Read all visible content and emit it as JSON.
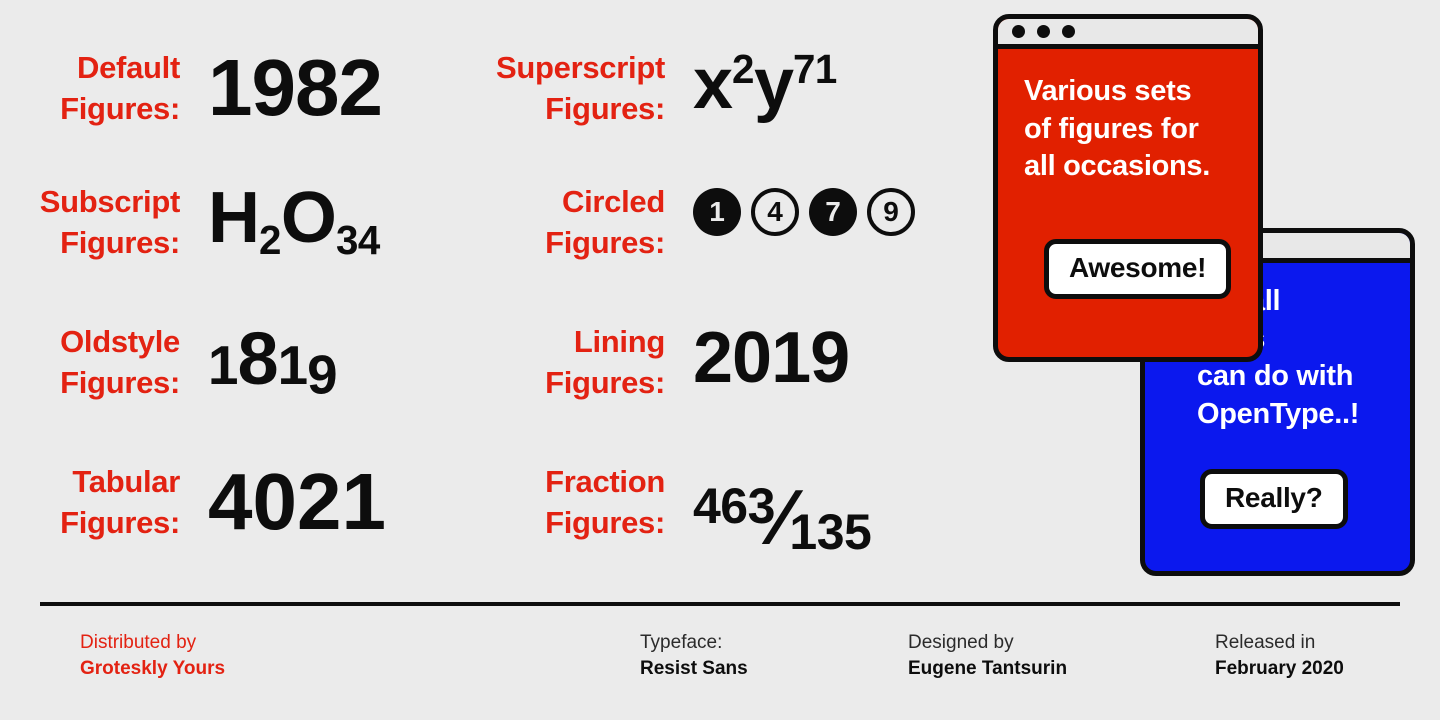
{
  "theme": {
    "background": "#ebebeb",
    "accent_red": "#e32212",
    "window_red": "#e12000",
    "window_blue": "#0b18ee",
    "ink": "#0d0d0d",
    "titlebar": "#e8e8e8"
  },
  "specimen": {
    "rows": [
      {
        "label": "Default\nFigures:",
        "sample": "1982",
        "kind": "default"
      },
      {
        "label": "Superscript\nFigures:",
        "sample_base_1": "x",
        "sample_sup_1": "2",
        "sample_base_2": "y",
        "sample_sup_2": "71",
        "kind": "superscript"
      },
      {
        "label": "Subscript\nFigures:",
        "sample_base_1": "H",
        "sample_sub_1": "2",
        "sample_base_2": "O",
        "sample_sub_2": "34",
        "kind": "subscript"
      },
      {
        "label": "Circled\nFigures:",
        "circled": [
          {
            "value": "1",
            "style": "filled"
          },
          {
            "value": "4",
            "style": "outline"
          },
          {
            "value": "7",
            "style": "filled"
          },
          {
            "value": "9",
            "style": "outline"
          }
        ],
        "kind": "circled"
      },
      {
        "label": "Oldstyle\nFigures:",
        "sample_part_1": "1",
        "sample_part_2": "8",
        "sample_part_3": "1",
        "sample_part_4": "9",
        "kind": "oldstyle"
      },
      {
        "label": "Lining\nFigures:",
        "sample": "2019",
        "kind": "lining"
      },
      {
        "label": "Tabular\nFigures:",
        "sample": "4021",
        "kind": "tabular"
      },
      {
        "label": "Fraction\nFigures:",
        "numerator": "463",
        "slash": "⁄",
        "denominator": "135",
        "kind": "fraction"
      }
    ]
  },
  "windows": {
    "red": {
      "title_dots": 3,
      "text": "Various sets\nof figures for\nall occasions.",
      "button_label": "Awesome!"
    },
    "blue": {
      "text": "not all\nSans\ncan do with\nOpenType..!",
      "button_label": "Really?"
    }
  },
  "footer": {
    "columns": [
      {
        "top": "Distributed by",
        "bottom": "Groteskly Yours",
        "tone": "red"
      },
      {
        "top": "Typeface:",
        "bottom": "Resist Sans",
        "tone": "dark"
      },
      {
        "top": "Designed by",
        "bottom": "Eugene Tantsurin",
        "tone": "dark"
      },
      {
        "top": "Released in",
        "bottom": "February 2020",
        "tone": "dark"
      }
    ]
  }
}
